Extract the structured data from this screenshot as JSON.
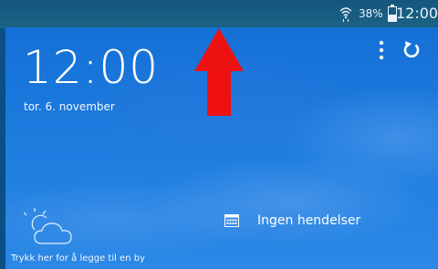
{
  "status_bar": {
    "battery_percent": "38%",
    "time": "12:00",
    "icons": [
      "wifi-icon",
      "battery-icon"
    ]
  },
  "clock": {
    "time": "12:00",
    "date": "tor. 6. november"
  },
  "toolbar": {
    "icons": [
      "menu-dots-icon",
      "refresh-icon"
    ]
  },
  "weather": {
    "icon": "partly-cloudy-icon",
    "hint": "Trykk her for å legge til en by"
  },
  "calendar": {
    "icon": "calendar-icon",
    "events_label": "Ingen hendelser"
  },
  "overlay": {
    "icon": "up-arrow-icon",
    "color": "#ee1111"
  },
  "colors": {
    "status_bar": "#15567e",
    "widget_blue": "#1a75dc",
    "text": "#ffffff"
  }
}
